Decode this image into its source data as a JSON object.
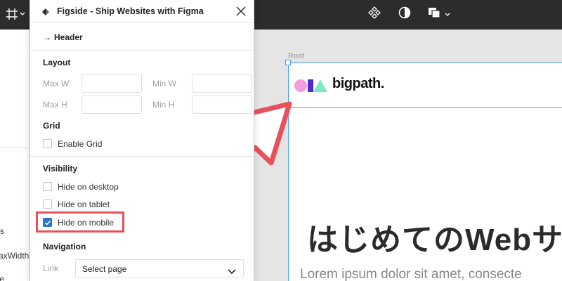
{
  "toolbar": {
    "icons": [
      "frame-icon",
      "chevron-down-icon",
      "components-icon",
      "contrast-icon",
      "layers-stack-icon"
    ]
  },
  "layers_panel": {
    "partial_lines": [
      "s",
      "axWidth",
      "te"
    ]
  },
  "plugin": {
    "title": "Figside - Ship Websites with Figma",
    "breadcrumb_arrow": "→",
    "breadcrumb": "Header",
    "layout": {
      "heading": "Layout",
      "max_w_label": "Max W",
      "min_w_label": "Min W",
      "max_h_label": "Max H",
      "min_h_label": "Min H",
      "max_w_value": "",
      "min_w_value": "",
      "max_h_value": "",
      "min_h_value": ""
    },
    "grid": {
      "heading": "Grid",
      "enable_label": "Enable Grid",
      "enabled": false
    },
    "visibility": {
      "heading": "Visibility",
      "options": [
        {
          "label": "Hide on desktop",
          "checked": false
        },
        {
          "label": "Hide on tablet",
          "checked": false
        },
        {
          "label": "Hide on mobile",
          "checked": true
        }
      ]
    },
    "navigation": {
      "heading": "Navigation",
      "link_label": "Link",
      "select_value": "Select page"
    }
  },
  "canvas": {
    "frame_label": "Root",
    "brand": "bigpath.",
    "hero": "はじめてのWebサ",
    "body": "Lorem ipsum dolor sit amet, consecte",
    "colors": {
      "selection": "#4a9be8",
      "circle": "#f29de0",
      "square": "#4b2dd6",
      "triangle": "#7fe8c9",
      "annotation": "#e8505b",
      "checkbox": "#2e74c9"
    }
  }
}
